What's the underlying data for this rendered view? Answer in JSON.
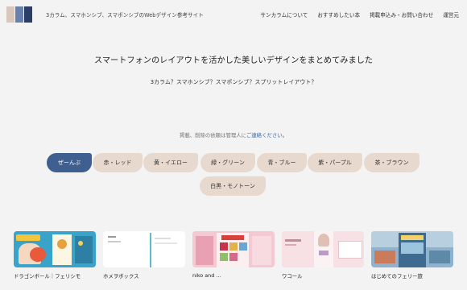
{
  "header": {
    "site_name": "3カラム、スマホンシブ、スマポンシブのWebデザイン参考サイト",
    "logo_colors": [
      "#d9c7bb",
      "#6882ad",
      "#2b3f66"
    ],
    "nav": [
      "サンカラムについて",
      "おすすめしたい本",
      "掲載申込み・お問い合わせ",
      "運営元"
    ]
  },
  "hero": {
    "title": "スマートフォンのレイアウトを活かした美しいデザインをまとめてみました",
    "subtitle": "3カラム？スマホンシブ？スマポンシブ？スプリットレイアウト？"
  },
  "notice": {
    "prefix": "掲載、削除の依頼は管理人に",
    "link": "ご連絡ください。"
  },
  "filters": [
    "ぜーんぶ",
    "赤・レッド",
    "黄・イエロー",
    "緑・グリーン",
    "青・ブルー",
    "紫・パープル",
    "茶・ブラウン",
    "白黒・モノトーン"
  ],
  "active_filter": "ぜーんぶ",
  "colors": {
    "accent": "#3e5f8f",
    "pill": "#e8d9cf",
    "link": "#3e69a6"
  },
  "cards": [
    {
      "caption": "ドラゴンボール｜フェリシモ"
    },
    {
      "caption": "ホメヲボックス"
    },
    {
      "caption": "niko and …"
    },
    {
      "caption": "ワコール"
    },
    {
      "caption": "はじめてのフェリー旅"
    }
  ]
}
